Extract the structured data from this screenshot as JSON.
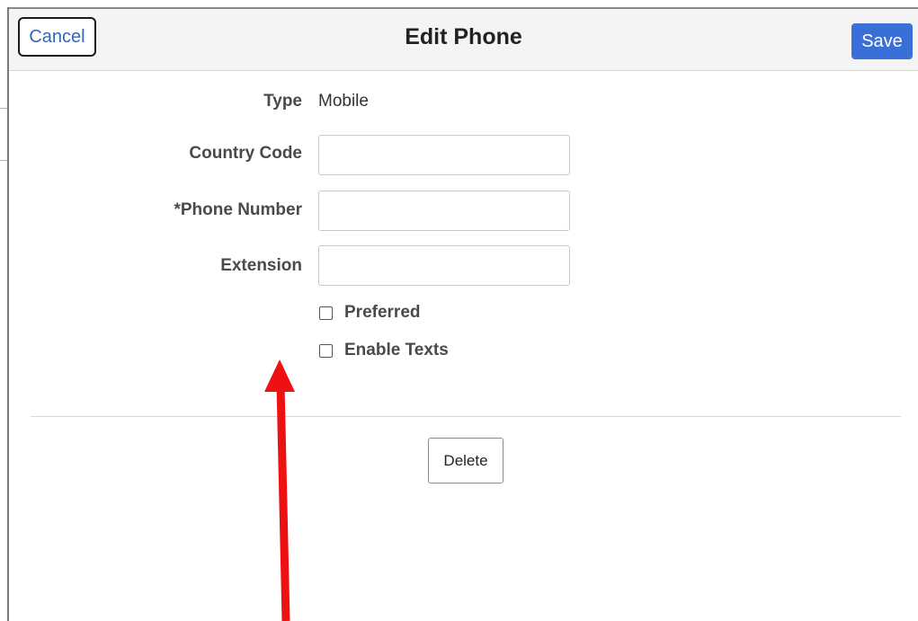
{
  "header": {
    "cancel_label": "Cancel",
    "title": "Edit Phone",
    "save_label": "Save"
  },
  "form": {
    "type_label": "Type",
    "type_value": "Mobile",
    "country_code_label": "Country Code",
    "country_code_value": "",
    "phone_number_label": "*Phone Number",
    "phone_number_value": "",
    "extension_label": "Extension",
    "extension_value": "",
    "preferred_label": "Preferred",
    "preferred_checked": false,
    "enable_texts_label": "Enable Texts",
    "enable_texts_checked": false
  },
  "footer": {
    "delete_label": "Delete"
  },
  "annotation": {
    "arrow_color": "#ee1111",
    "arrow_icon": "up-arrow-annotation"
  },
  "colors": {
    "save_bg": "#3a6fd8",
    "cancel_text": "#3366bb"
  }
}
